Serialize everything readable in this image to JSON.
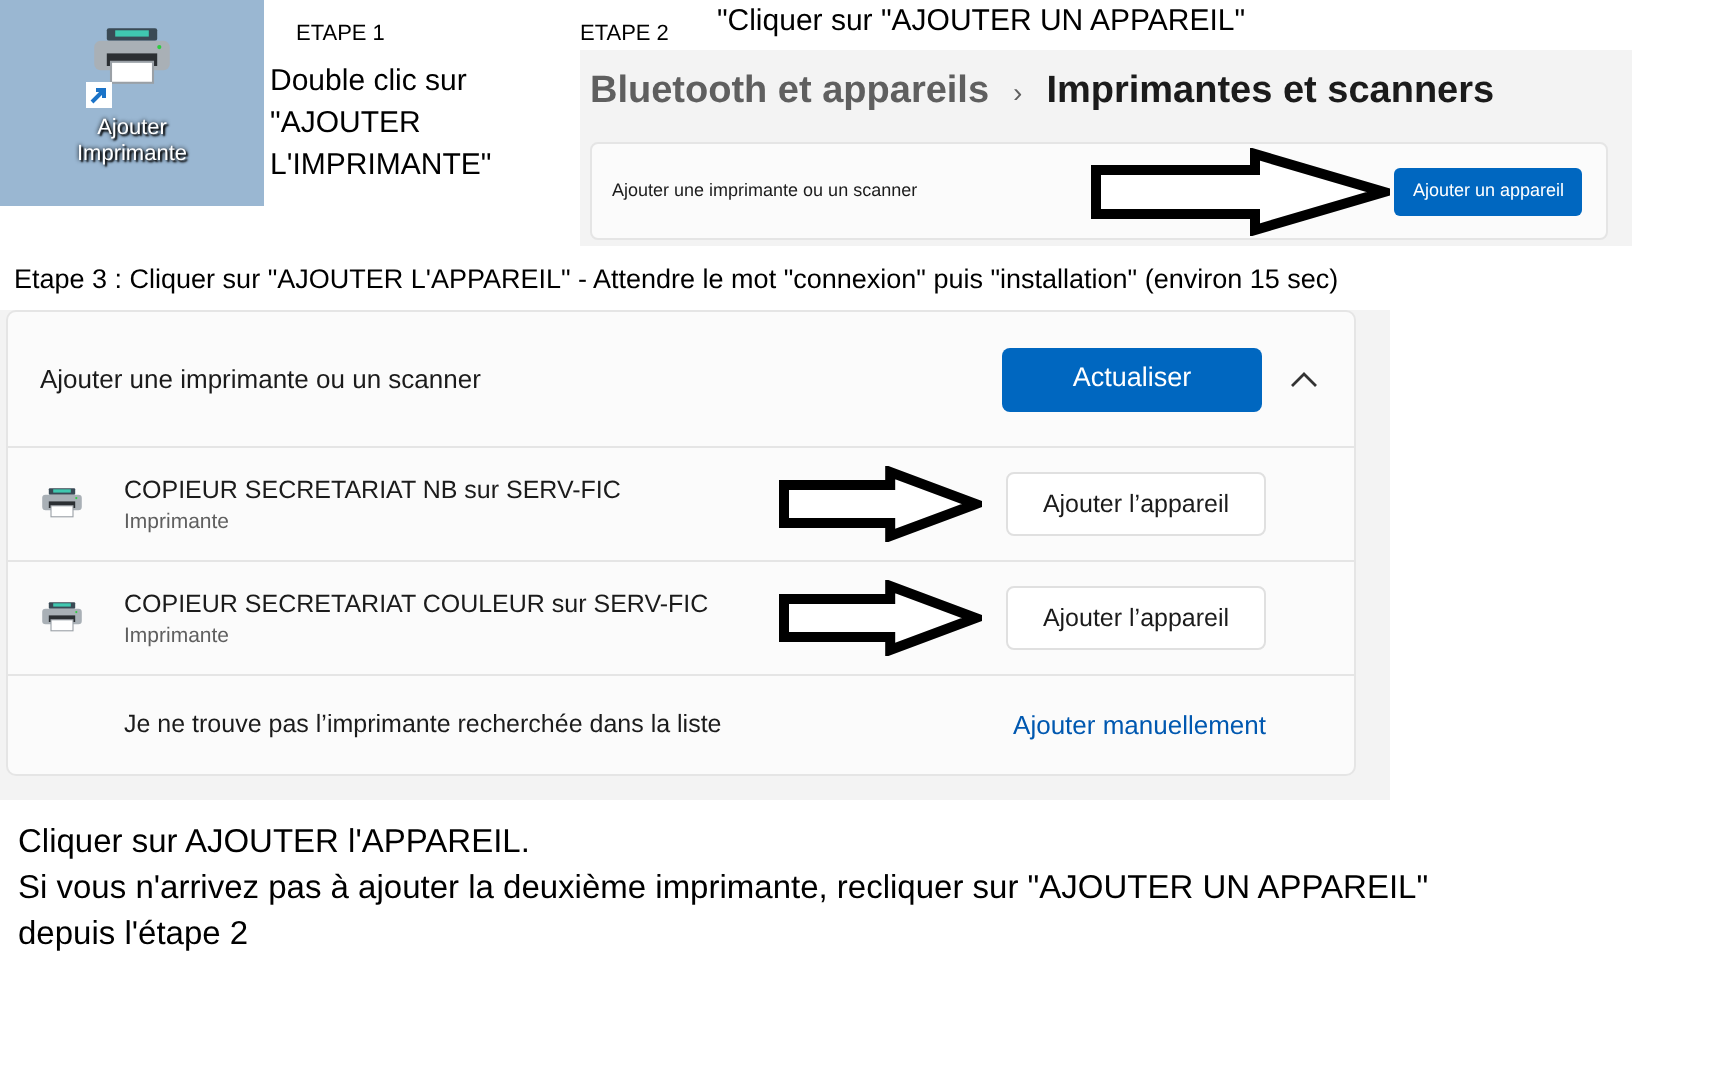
{
  "step1": {
    "label": "ETAPE 1",
    "instruction": "Double clic sur \"AJOUTER L'IMPRIMANTE\"",
    "desktop_icon": {
      "label": "Ajouter Imprimante"
    }
  },
  "step2": {
    "label": "ETAPE 2",
    "instruction": "\"Cliquer sur \"AJOUTER UN APPAREIL\"",
    "breadcrumb": {
      "parent": "Bluetooth et appareils",
      "separator": "›",
      "current": "Imprimantes et scanners"
    },
    "card": {
      "text": "Ajouter une imprimante ou un scanner",
      "button": "Ajouter un appareil"
    }
  },
  "step3": {
    "instruction": "Etape 3 : Cliquer sur \"AJOUTER L'APPAREIL\" - Attendre le mot \"connexion\" puis \"installation\" (environ 15 sec)",
    "panel": {
      "title": "Ajouter une imprimante ou un scanner",
      "refresh_button": "Actualiser",
      "expanded": true,
      "devices": [
        {
          "name": "COPIEUR SECRETARIAT NB sur SERV-FIC",
          "type": "Imprimante",
          "button": "Ajouter l’appareil"
        },
        {
          "name": "COPIEUR SECRETARIAT COULEUR sur SERV-FIC",
          "type": "Imprimante",
          "button": "Ajouter l’appareil"
        }
      ],
      "footer": {
        "text": "Je ne trouve pas l’imprimante recherchée dans la liste",
        "link": "Ajouter manuellement"
      }
    }
  },
  "notes": [
    "Cliquer sur AJOUTER l'APPAREIL.",
    "Si vous n'arrivez pas à ajouter la deuxième imprimante, recliquer sur \"AJOUTER UN APPAREIL\" depuis l'étape 2"
  ]
}
